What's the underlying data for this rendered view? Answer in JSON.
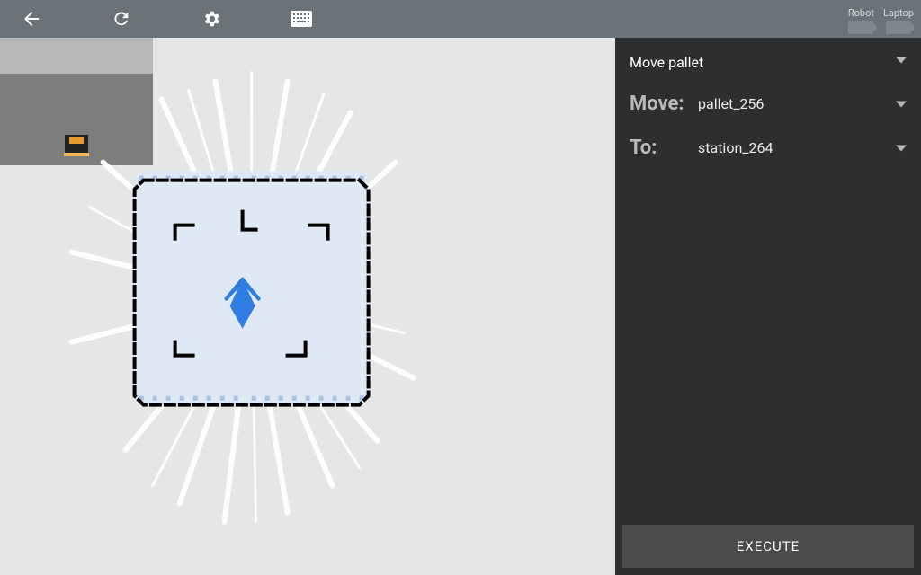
{
  "topbar": {
    "back_icon": "back-icon",
    "reload_icon": "reload-icon",
    "settings_icon": "gear-icon",
    "keyboard_icon": "keyboard-icon"
  },
  "battery": {
    "robot_label": "Robot",
    "laptop_label": "Laptop"
  },
  "task": {
    "title": "Move pallet",
    "move_label": "Move:",
    "move_value": "pallet_256",
    "to_label": "To:",
    "to_value": "station_264",
    "execute_label": "EXECUTE"
  },
  "map": {
    "robot_heading": 0
  }
}
